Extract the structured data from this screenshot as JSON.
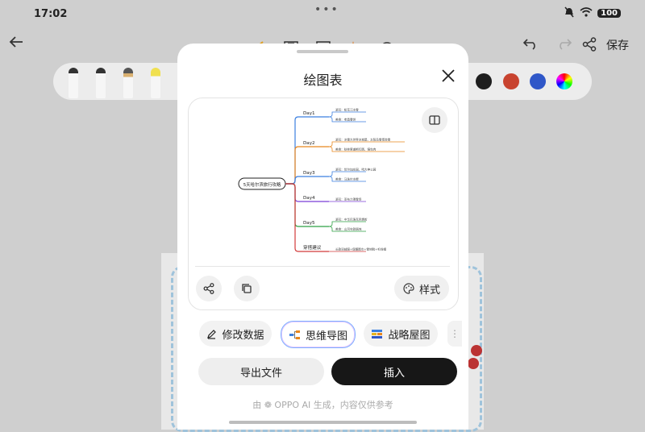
{
  "status_bar": {
    "time": "17:02",
    "battery": "100"
  },
  "toolbar": {
    "save_label": "保存"
  },
  "pen_tray": {
    "colors": [
      "#1e1e1e",
      "#c8432f",
      "#2f57c8"
    ]
  },
  "dialog": {
    "title": "绘图表",
    "style_label": "样式",
    "chips": [
      {
        "label": "修改数据",
        "icon": "edit-icon"
      },
      {
        "label": "思维导图",
        "icon": "mindmap-icon",
        "selected": true
      },
      {
        "label": "战略屋图",
        "icon": "strategy-house-icon"
      }
    ],
    "export_label": "导出文件",
    "insert_label": "插入",
    "footer_note": "由 ❁ OPPO AI 生成，内容仅供参考"
  },
  "mind_map": {
    "root": "5天哈尔滨旅行攻略",
    "branches": [
      {
        "name": "Day1",
        "color": "#3b7fe0",
        "items": [
          "游玩：松花江冰雪",
          "美食：老昌春饼"
        ]
      },
      {
        "name": "Day2",
        "color": "#e8871e",
        "items": [
          "游玩：冰雪大世界冰城堡、太阳岛雪博会雪",
          "美食：秋林里道斯红肠、锅包肉"
        ]
      },
      {
        "name": "Day3",
        "color": "#3b7fe0",
        "items": [
          "游玩：伏尔加庄园、哈大神公园",
          "美食：马迭尔冰棍"
        ]
      },
      {
        "name": "Day4",
        "color": "#7b3fd6",
        "items": [
          "游玩：亚布力滑雪场"
        ]
      },
      {
        "name": "Day5",
        "color": "#2ea043",
        "items": [
          "游玩：中华巴洛克风情街",
          "美食：山河屯铁锅炖"
        ]
      },
      {
        "name": "穿搭建议",
        "color": "#d23a3a",
        "items": [
          "长款羽绒服+保暖围巾+雪地靴+毛线帽"
        ]
      }
    ]
  }
}
